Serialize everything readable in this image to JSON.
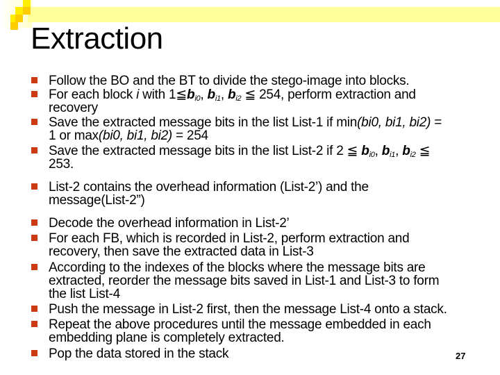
{
  "slide": {
    "title": "Extraction",
    "page_number": "27",
    "colors": {
      "band": "#FFFF99",
      "square_yellow": "#FFEE00",
      "square_orange": "#FFCC00",
      "bullet": "#CC3A14",
      "text": "#000000"
    },
    "bullet_icon": "square-bullet",
    "bullets": [
      {
        "lines": [
          "Follow the BO and the BT to divide the stego-image into blocks."
        ]
      },
      {
        "lines": [
          "For each block ",
          "i",
          " with 1≦",
          "b",
          "i0",
          ", ",
          "b",
          "i1",
          ", ",
          "b",
          "i2",
          " ≦ 254, perform extraction and",
          "recovery"
        ]
      },
      {
        "lines": [
          "Save the extracted message bits in the list List-1 if min",
          "(bi0, bi1, bi2)",
          " =",
          "1 or max",
          "(bi0, bi1, bi2)",
          " = 254"
        ]
      },
      {
        "lines": [
          "Save the extracted message bits in the list List-2 if 2 ≦ ",
          "b",
          "i0",
          ", ",
          "b",
          "i1",
          ", ",
          "b",
          "i2",
          " ≦",
          "253."
        ]
      },
      {
        "lines": [
          "List-2 contains the overhead information (List-2’) and the",
          "message(List-2”)"
        ]
      },
      {
        "lines": [
          "Decode the overhead information in List-2’"
        ]
      },
      {
        "lines": [
          "For each FB, which is recorded in List-2, perform extraction and",
          "recovery, then save the extracted data in List-3"
        ]
      },
      {
        "lines": [
          "According to the indexes of the blocks where the message bits are",
          "extracted, reorder the message bits saved in List-1 and List-3 to form",
          "the list List-4"
        ]
      },
      {
        "lines": [
          "Push the message in List-2 first, then the message List-4 onto a stack."
        ]
      },
      {
        "lines": [
          "Repeat the above procedures until the message embedded in each",
          "embedding plane is completely extracted."
        ]
      },
      {
        "lines": [
          "Pop the data stored in the stack"
        ]
      }
    ]
  }
}
